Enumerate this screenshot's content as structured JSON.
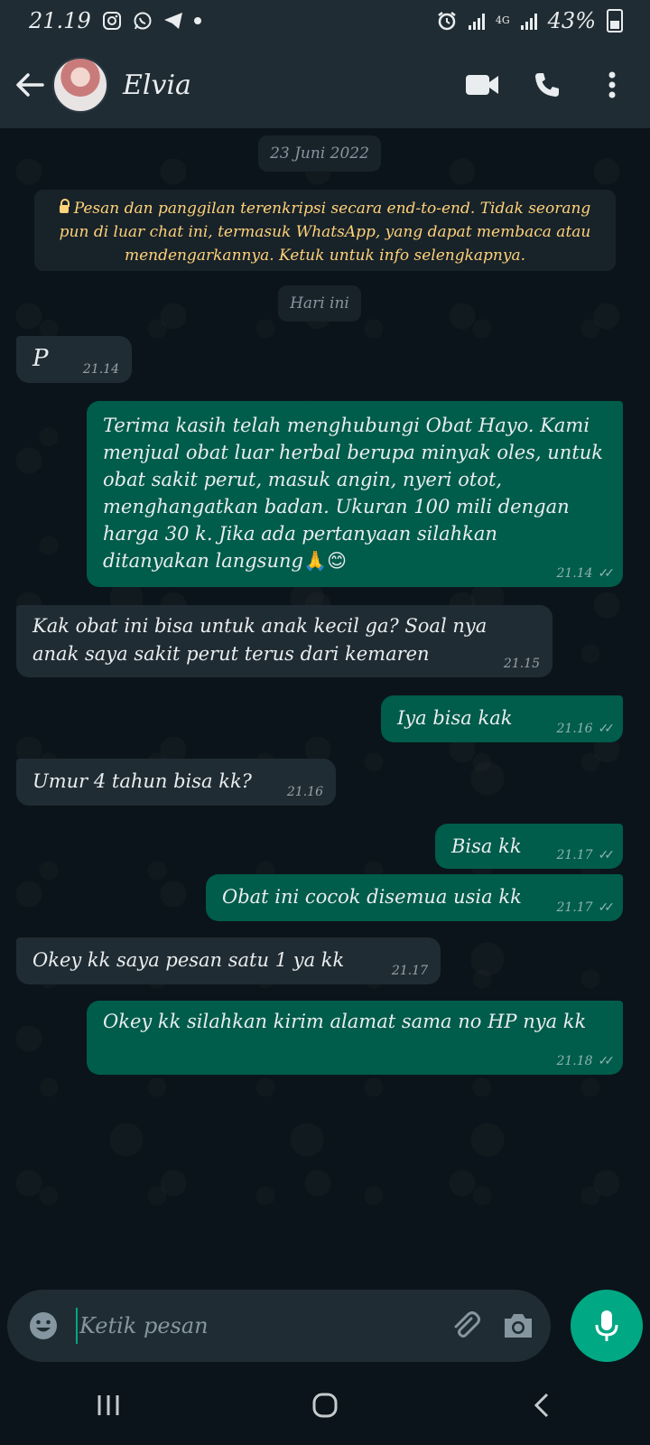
{
  "status_bar": {
    "time": "21.19",
    "battery": "43%",
    "network": "4G"
  },
  "header": {
    "contact_name": "Elvia"
  },
  "chat": {
    "date_pill": "23 Juni 2022",
    "encryption_notice": "Pesan dan panggilan terenkripsi secara end-to-end. Tidak seorang pun di luar chat ini, termasuk WhatsApp, yang dapat membaca atau mendengarkannya. Ketuk untuk info selengkapnya.",
    "today_pill": "Hari ini",
    "messages": [
      {
        "dir": "in",
        "text": "P",
        "time": "21.14"
      },
      {
        "dir": "out",
        "text": "Terima kasih telah menghubungi Obat Hayo. Kami menjual obat luar herbal berupa minyak oles, untuk obat sakit perut, masuk angin, nyeri otot, menghangatkan badan. Ukuran 100 mili dengan harga 30 k. Jika ada pertanyaan silahkan ditanyakan langsung",
        "emoji": "🙏😊",
        "time": "21.14"
      },
      {
        "dir": "in",
        "text": "Kak obat ini bisa untuk anak kecil ga? Soal nya anak saya sakit perut terus dari kemaren",
        "time": "21.15"
      },
      {
        "dir": "out",
        "text": "Iya bisa kak",
        "time": "21.16"
      },
      {
        "dir": "in",
        "text": "Umur 4 tahun bisa kk?",
        "time": "21.16"
      },
      {
        "dir": "out",
        "text": "Bisa kk",
        "time": "21.17"
      },
      {
        "dir": "out",
        "text": "Obat ini cocok disemua usia kk",
        "time": "21.17"
      },
      {
        "dir": "in",
        "text": "Okey kk saya pesan satu 1 ya kk",
        "time": "21.17"
      },
      {
        "dir": "out",
        "text": "Okey kk silahkan kirim alamat sama no HP nya kk",
        "time": "21.18"
      }
    ]
  },
  "input": {
    "placeholder": "Ketik pesan"
  },
  "colors": {
    "background": "#0b141a",
    "bar": "#202c33",
    "outgoing_bubble": "#005c4b",
    "incoming_bubble": "#202c33",
    "accent": "#00a884",
    "notice_text": "#ffd279"
  }
}
